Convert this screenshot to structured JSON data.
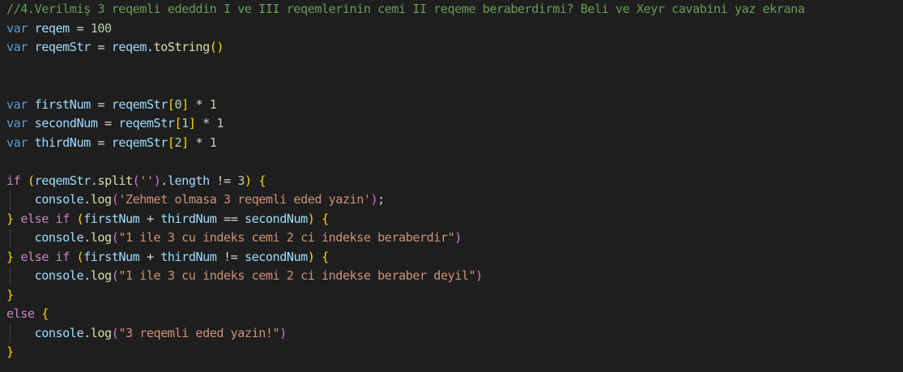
{
  "editor": {
    "theme_colors": {
      "background": "#1e1e1e",
      "keyword": "#569cd6",
      "control": "#c586c0",
      "variable": "#9cdcfe",
      "function": "#dcdcaa",
      "number": "#b5cea8",
      "string": "#ce9178",
      "comment": "#6a9955",
      "bracket1": "#ffd700",
      "bracket2": "#da70d6",
      "bracket3": "#179fff"
    },
    "lines": [
      [
        {
          "t": "//4.Verilmiş 3 reqemli ededdin I ve III reqemlerinin cemi II reqeme beraberdirmi? Beli ve Xeyr cavabini yaz ekrana",
          "c": "cm"
        }
      ],
      [
        {
          "t": "var",
          "c": "kw"
        },
        {
          "t": " ",
          "c": "op"
        },
        {
          "t": "reqem",
          "c": "var"
        },
        {
          "t": " = ",
          "c": "op"
        },
        {
          "t": "100",
          "c": "num"
        }
      ],
      [
        {
          "t": "var",
          "c": "kw"
        },
        {
          "t": " ",
          "c": "op"
        },
        {
          "t": "reqemStr",
          "c": "var"
        },
        {
          "t": " = ",
          "c": "op"
        },
        {
          "t": "reqem",
          "c": "var"
        },
        {
          "t": ".",
          "c": "op"
        },
        {
          "t": "toString",
          "c": "fn"
        },
        {
          "t": "()",
          "c": "b1"
        }
      ],
      [],
      [],
      [
        {
          "t": "var",
          "c": "kw"
        },
        {
          "t": " ",
          "c": "op"
        },
        {
          "t": "firstNum",
          "c": "var"
        },
        {
          "t": " = ",
          "c": "op"
        },
        {
          "t": "reqemStr",
          "c": "var"
        },
        {
          "t": "[",
          "c": "b1"
        },
        {
          "t": "0",
          "c": "num"
        },
        {
          "t": "]",
          "c": "b1"
        },
        {
          "t": " * ",
          "c": "op"
        },
        {
          "t": "1",
          "c": "num"
        }
      ],
      [
        {
          "t": "var",
          "c": "kw"
        },
        {
          "t": " ",
          "c": "op"
        },
        {
          "t": "secondNum",
          "c": "var"
        },
        {
          "t": " = ",
          "c": "op"
        },
        {
          "t": "reqemStr",
          "c": "var"
        },
        {
          "t": "[",
          "c": "b1"
        },
        {
          "t": "1",
          "c": "num"
        },
        {
          "t": "]",
          "c": "b1"
        },
        {
          "t": " * ",
          "c": "op"
        },
        {
          "t": "1",
          "c": "num"
        }
      ],
      [
        {
          "t": "var",
          "c": "kw"
        },
        {
          "t": " ",
          "c": "op"
        },
        {
          "t": "thirdNum",
          "c": "var"
        },
        {
          "t": " = ",
          "c": "op"
        },
        {
          "t": "reqemStr",
          "c": "var"
        },
        {
          "t": "[",
          "c": "b1"
        },
        {
          "t": "2",
          "c": "num"
        },
        {
          "t": "]",
          "c": "b1"
        },
        {
          "t": " * ",
          "c": "op"
        },
        {
          "t": "1",
          "c": "num"
        }
      ],
      [],
      [
        {
          "t": "if",
          "c": "cf"
        },
        {
          "t": " ",
          "c": "op"
        },
        {
          "t": "(",
          "c": "b1"
        },
        {
          "t": "reqemStr",
          "c": "var"
        },
        {
          "t": ".",
          "c": "op"
        },
        {
          "t": "split",
          "c": "fn"
        },
        {
          "t": "(",
          "c": "b2"
        },
        {
          "t": "''",
          "c": "str"
        },
        {
          "t": ")",
          "c": "b2"
        },
        {
          "t": ".",
          "c": "op"
        },
        {
          "t": "length",
          "c": "var"
        },
        {
          "t": " != ",
          "c": "op"
        },
        {
          "t": "3",
          "c": "num"
        },
        {
          "t": ")",
          "c": "b1"
        },
        {
          "t": " ",
          "c": "op"
        },
        {
          "t": "{",
          "c": "b1"
        }
      ],
      [
        {
          "t": "    ",
          "c": "op"
        },
        {
          "t": "console",
          "c": "var"
        },
        {
          "t": ".",
          "c": "op"
        },
        {
          "t": "log",
          "c": "fn"
        },
        {
          "t": "(",
          "c": "b2"
        },
        {
          "t": "'Zehmet olmasa 3 reqemli eded yazin'",
          "c": "str"
        },
        {
          "t": ")",
          "c": "b2"
        },
        {
          "t": ";",
          "c": "op"
        }
      ],
      [
        {
          "t": "}",
          "c": "b1"
        },
        {
          "t": " ",
          "c": "op"
        },
        {
          "t": "else",
          "c": "cf"
        },
        {
          "t": " ",
          "c": "op"
        },
        {
          "t": "if",
          "c": "cf"
        },
        {
          "t": " ",
          "c": "op"
        },
        {
          "t": "(",
          "c": "b1"
        },
        {
          "t": "firstNum",
          "c": "var"
        },
        {
          "t": " + ",
          "c": "op"
        },
        {
          "t": "thirdNum",
          "c": "var"
        },
        {
          "t": " == ",
          "c": "op"
        },
        {
          "t": "secondNum",
          "c": "var"
        },
        {
          "t": ")",
          "c": "b1"
        },
        {
          "t": " ",
          "c": "op"
        },
        {
          "t": "{",
          "c": "b1"
        }
      ],
      [
        {
          "t": "    ",
          "c": "op"
        },
        {
          "t": "console",
          "c": "var"
        },
        {
          "t": ".",
          "c": "op"
        },
        {
          "t": "log",
          "c": "fn"
        },
        {
          "t": "(",
          "c": "b2"
        },
        {
          "t": "\"1 ile 3 cu indeks cemi 2 ci indekse beraberdir\"",
          "c": "str"
        },
        {
          "t": ")",
          "c": "b2"
        }
      ],
      [
        {
          "t": "}",
          "c": "b1"
        },
        {
          "t": " ",
          "c": "op"
        },
        {
          "t": "else",
          "c": "cf"
        },
        {
          "t": " ",
          "c": "op"
        },
        {
          "t": "if",
          "c": "cf"
        },
        {
          "t": " ",
          "c": "op"
        },
        {
          "t": "(",
          "c": "b1"
        },
        {
          "t": "firstNum",
          "c": "var"
        },
        {
          "t": " + ",
          "c": "op"
        },
        {
          "t": "thirdNum",
          "c": "var"
        },
        {
          "t": " != ",
          "c": "op"
        },
        {
          "t": "secondNum",
          "c": "var"
        },
        {
          "t": ")",
          "c": "b1"
        },
        {
          "t": " ",
          "c": "op"
        },
        {
          "t": "{",
          "c": "b1"
        }
      ],
      [
        {
          "t": "    ",
          "c": "op"
        },
        {
          "t": "console",
          "c": "var"
        },
        {
          "t": ".",
          "c": "op"
        },
        {
          "t": "log",
          "c": "fn"
        },
        {
          "t": "(",
          "c": "b2"
        },
        {
          "t": "\"1 ile 3 cu indeks cemi 2 ci indekse beraber deyil\"",
          "c": "str"
        },
        {
          "t": ")",
          "c": "b2"
        }
      ],
      [
        {
          "t": "}",
          "c": "b1"
        }
      ],
      [
        {
          "t": "else",
          "c": "cf"
        },
        {
          "t": " ",
          "c": "op"
        },
        {
          "t": "{",
          "c": "b1"
        }
      ],
      [
        {
          "t": "    ",
          "c": "op"
        },
        {
          "t": "console",
          "c": "var"
        },
        {
          "t": ".",
          "c": "op"
        },
        {
          "t": "log",
          "c": "fn"
        },
        {
          "t": "(",
          "c": "b2"
        },
        {
          "t": "\"3 reqemli eded yazin!\"",
          "c": "str"
        },
        {
          "t": ")",
          "c": "b2"
        }
      ],
      [
        {
          "t": "}",
          "c": "b1"
        }
      ]
    ]
  }
}
